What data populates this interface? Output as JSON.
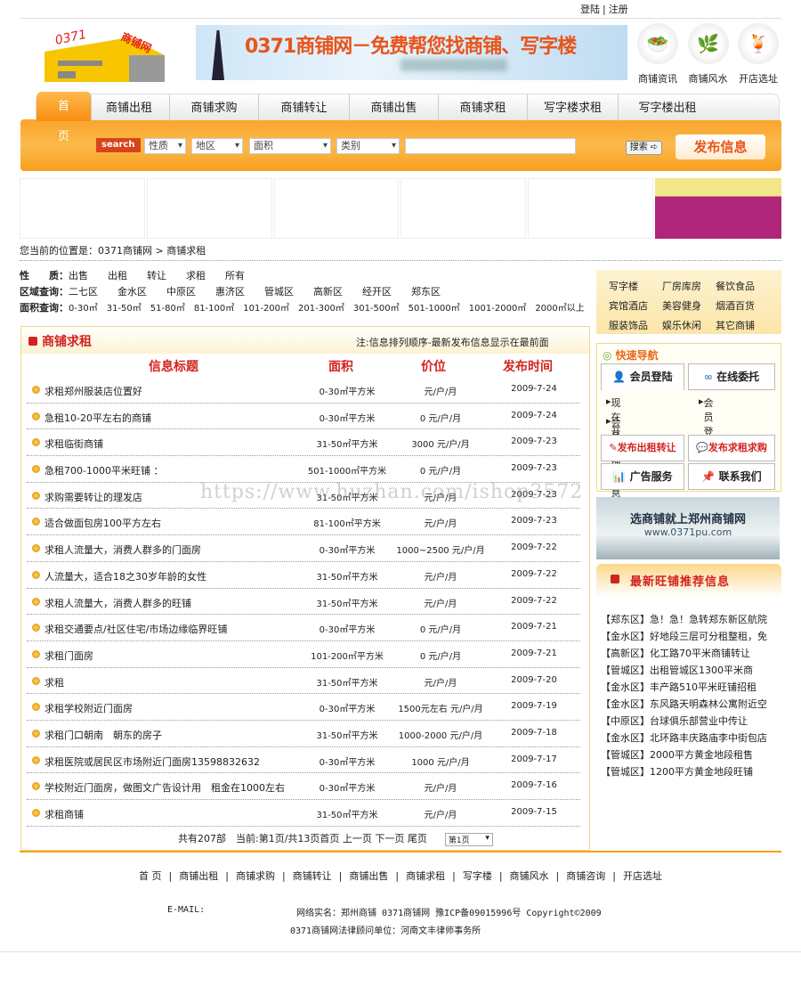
{
  "top_links": {
    "login": "登陆",
    "register": "注册"
  },
  "logo": {
    "text": "0371商铺网"
  },
  "banner": {
    "text": "0371商铺网－免费帮您找商铺、写字楼"
  },
  "quick_icons": [
    {
      "label": "商铺资讯",
      "icon": "salad-icon"
    },
    {
      "label": "商铺风水",
      "icon": "plant-icon"
    },
    {
      "label": "开店选址",
      "icon": "cup-icon"
    }
  ],
  "nav": [
    "首 页",
    "商铺出租",
    "商铺求购",
    "商铺转让",
    "商铺出售",
    "商铺求租",
    "写字楼求租",
    "写字楼出租"
  ],
  "search": {
    "label": "search",
    "selects": [
      "性质",
      "地区",
      "面积",
      "类别"
    ],
    "keyword": "",
    "search_button": "搜索",
    "publish_button": "发布信息"
  },
  "breadcrumb": {
    "prefix": "您当前的位置是：",
    "items": [
      "0371商铺网",
      "商铺求租"
    ],
    "sep": ">"
  },
  "filters": {
    "nature": {
      "label": "性　　质：",
      "items": [
        "出售",
        "出租",
        "转让",
        "求租",
        "所有"
      ]
    },
    "region": {
      "label": "区域查询：",
      "items": [
        "二七区",
        "金水区",
        "中原区",
        "惠济区",
        "管城区",
        "高新区",
        "经开区",
        "郑东区"
      ]
    },
    "area": {
      "label": "面积查询：",
      "items": [
        "0-30㎡",
        "31-50㎡",
        "51-80㎡",
        "81-100㎡",
        "101-200㎡",
        "201-300㎡",
        "301-500㎡",
        "501-1000㎡",
        "1001-2000㎡",
        "2000㎡以上"
      ]
    }
  },
  "listing": {
    "title": "商铺求租",
    "note": "注:信息排列顺序-最新发布信息显示在最前面",
    "columns": [
      "信息标题",
      "面积",
      "价位",
      "发布时间"
    ],
    "rows": [
      {
        "title": "求租郑州服装店位置好",
        "area": "0-30㎡平方米",
        "price": "元/户/月",
        "date": "2009-7-24"
      },
      {
        "title": "急租10-20平左右的商铺",
        "area": "0-30㎡平方米",
        "price": "0 元/户/月",
        "date": "2009-7-24"
      },
      {
        "title": "求租临街商铺",
        "area": "31-50㎡平方米",
        "price": "3000 元/户/月",
        "date": "2009-7-23"
      },
      {
        "title": "急租700-1000平米旺铺 ：",
        "area": "501-1000㎡平方米",
        "price": "0 元/户/月",
        "date": "2009-7-23"
      },
      {
        "title": "求购需要转让的理发店",
        "area": "31-50㎡平方米",
        "price": "元/户/月",
        "date": "2009-7-23"
      },
      {
        "title": "适合做面包房100平方左右",
        "area": "81-100㎡平方米",
        "price": "元/户/月",
        "date": "2009-7-23"
      },
      {
        "title": "求租人流量大，消费人群多的门面房",
        "area": "0-30㎡平方米",
        "price": "1000~2500 元/户/月",
        "date": "2009-7-22"
      },
      {
        "title": "人流量大，适合18之30岁年龄的女性",
        "area": "31-50㎡平方米",
        "price": "元/户/月",
        "date": "2009-7-22"
      },
      {
        "title": "求租人流量大，消费人群多的旺铺",
        "area": "31-50㎡平方米",
        "price": "元/户/月",
        "date": "2009-7-22"
      },
      {
        "title": "求租交通要点/社区住宅/市场边缘临界旺铺",
        "area": "0-30㎡平方米",
        "price": "0 元/户/月",
        "date": "2009-7-21"
      },
      {
        "title": "求租门面房",
        "area": "101-200㎡平方米",
        "price": "0 元/户/月",
        "date": "2009-7-21"
      },
      {
        "title": "求租",
        "area": "31-50㎡平方米",
        "price": "元/户/月",
        "date": "2009-7-20"
      },
      {
        "title": "求租学校附近门面房",
        "area": "0-30㎡平方米",
        "price": "1500元左右 元/户/月",
        "date": "2009-7-19"
      },
      {
        "title": "求租门口朝南　朝东的房子",
        "area": "31-50㎡平方米",
        "price": "1000-2000 元/户/月",
        "date": "2009-7-18"
      },
      {
        "title": "求租医院或居民区市场附近门面房13598832632",
        "area": "0-30㎡平方米",
        "price": "1000 元/户/月",
        "date": "2009-7-17"
      },
      {
        "title": "学校附近门面房，做图文广告设计用　租金在1000左右",
        "area": "0-30㎡平方米",
        "price": "元/户/月",
        "date": "2009-7-16"
      },
      {
        "title": "求租商铺",
        "area": "31-50㎡平方米",
        "price": "元/户/月",
        "date": "2009-7-15"
      }
    ],
    "pager": {
      "total": "共有207部",
      "current": "当前:第1页/共13页",
      "first": "首页",
      "prev": "上一页",
      "next": "下一页",
      "last": "尾页",
      "select": "第1页"
    }
  },
  "categories": [
    "写字楼",
    "厂房库房",
    "餐饮食品",
    "宾馆酒店",
    "美容健身",
    "烟酒百货",
    "服装饰品",
    "娱乐休闲",
    "其它商铺"
  ],
  "quick_nav": {
    "title": "快速导航",
    "member_login": "会员登陆",
    "online_entrust": "在线委托",
    "links": [
      "现在开始注册",
      "会员登录",
      "会员管理信息"
    ],
    "publish_rent": "发布出租转让",
    "publish_seek": "发布求租求购",
    "ads": "广告服务",
    "contact": "联系我们"
  },
  "side_banner": {
    "text": "选商铺就上郑州商铺网",
    "url_text": "www.0371pu.com"
  },
  "recommend": {
    "title": "最新旺铺推荐信息",
    "items": [
      "【郑东区】急！急！急转郑东新区航院",
      "【金水区】好地段三层可分租整租，免",
      "【高新区】化工路70平米商铺转让",
      "【管城区】出租管城区1300平米商",
      "【金水区】丰产路510平米旺铺招租",
      "【金水区】东风路天明森林公寓附近空",
      "【中原区】台球俱乐部营业中传让",
      "【金水区】北环路丰庆路庙李中街包店",
      "【管城区】2000平方黄金地段租售",
      "【管城区】1200平方黄金地段旺铺"
    ]
  },
  "footer": {
    "links": [
      "首 页",
      "商铺出租",
      "商铺求购",
      "商铺转让",
      "商铺出售",
      "商铺求租",
      "写字楼",
      "商铺风水",
      "商铺咨询",
      "开店选址"
    ],
    "email": "E-MAIL:",
    "record": "网络实名：郑州商铺 0371商铺网 豫ICP备09015996号 Copyright©2009",
    "legal": "0371商铺网法律顾问单位：河南文丰律师事务所"
  },
  "watermark": "https://www.huzhan.com/ishop3572"
}
